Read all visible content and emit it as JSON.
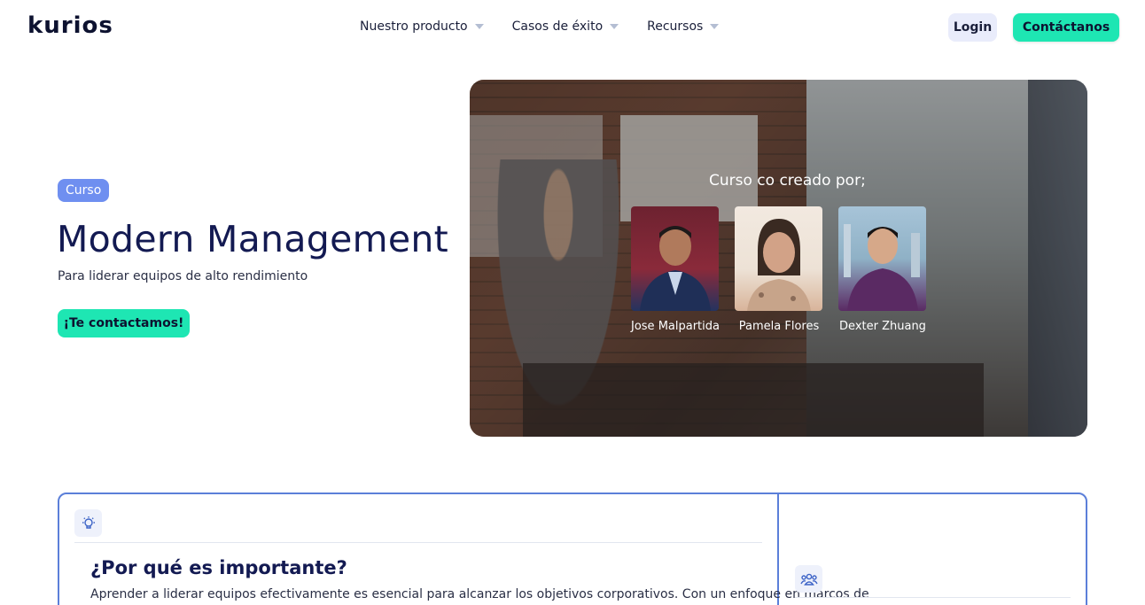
{
  "header": {
    "logo": "kurios",
    "nav": [
      {
        "label": "Nuestro producto"
      },
      {
        "label": "Casos de éxito"
      },
      {
        "label": "Recursos"
      }
    ],
    "login_label": "Login",
    "contact_label": "Contáctanos"
  },
  "hero": {
    "badge": "Curso",
    "title": "Modern Management",
    "subtitle": "Para liderar equipos de alto rendimiento",
    "cta_label": "¡Te contactamos!",
    "created_by_label": "Curso co creado por;",
    "authors": [
      {
        "name": "Jose Malpartida"
      },
      {
        "name": "Pamela Flores"
      },
      {
        "name": "Dexter Zhuang"
      }
    ]
  },
  "why": {
    "title": "¿Por qué es importante?",
    "text": "Aprender a liderar equipos efectivamente es esencial para alcanzar los objetivos corporativos. Con un enfoque en marcos de"
  },
  "colors": {
    "accent": "#1ee6b3",
    "navy": "#131a52",
    "badge": "#6f8ff0",
    "border": "#5b7fd9"
  },
  "icons": {
    "bulb": "lightbulb-icon",
    "team": "team-icon"
  }
}
